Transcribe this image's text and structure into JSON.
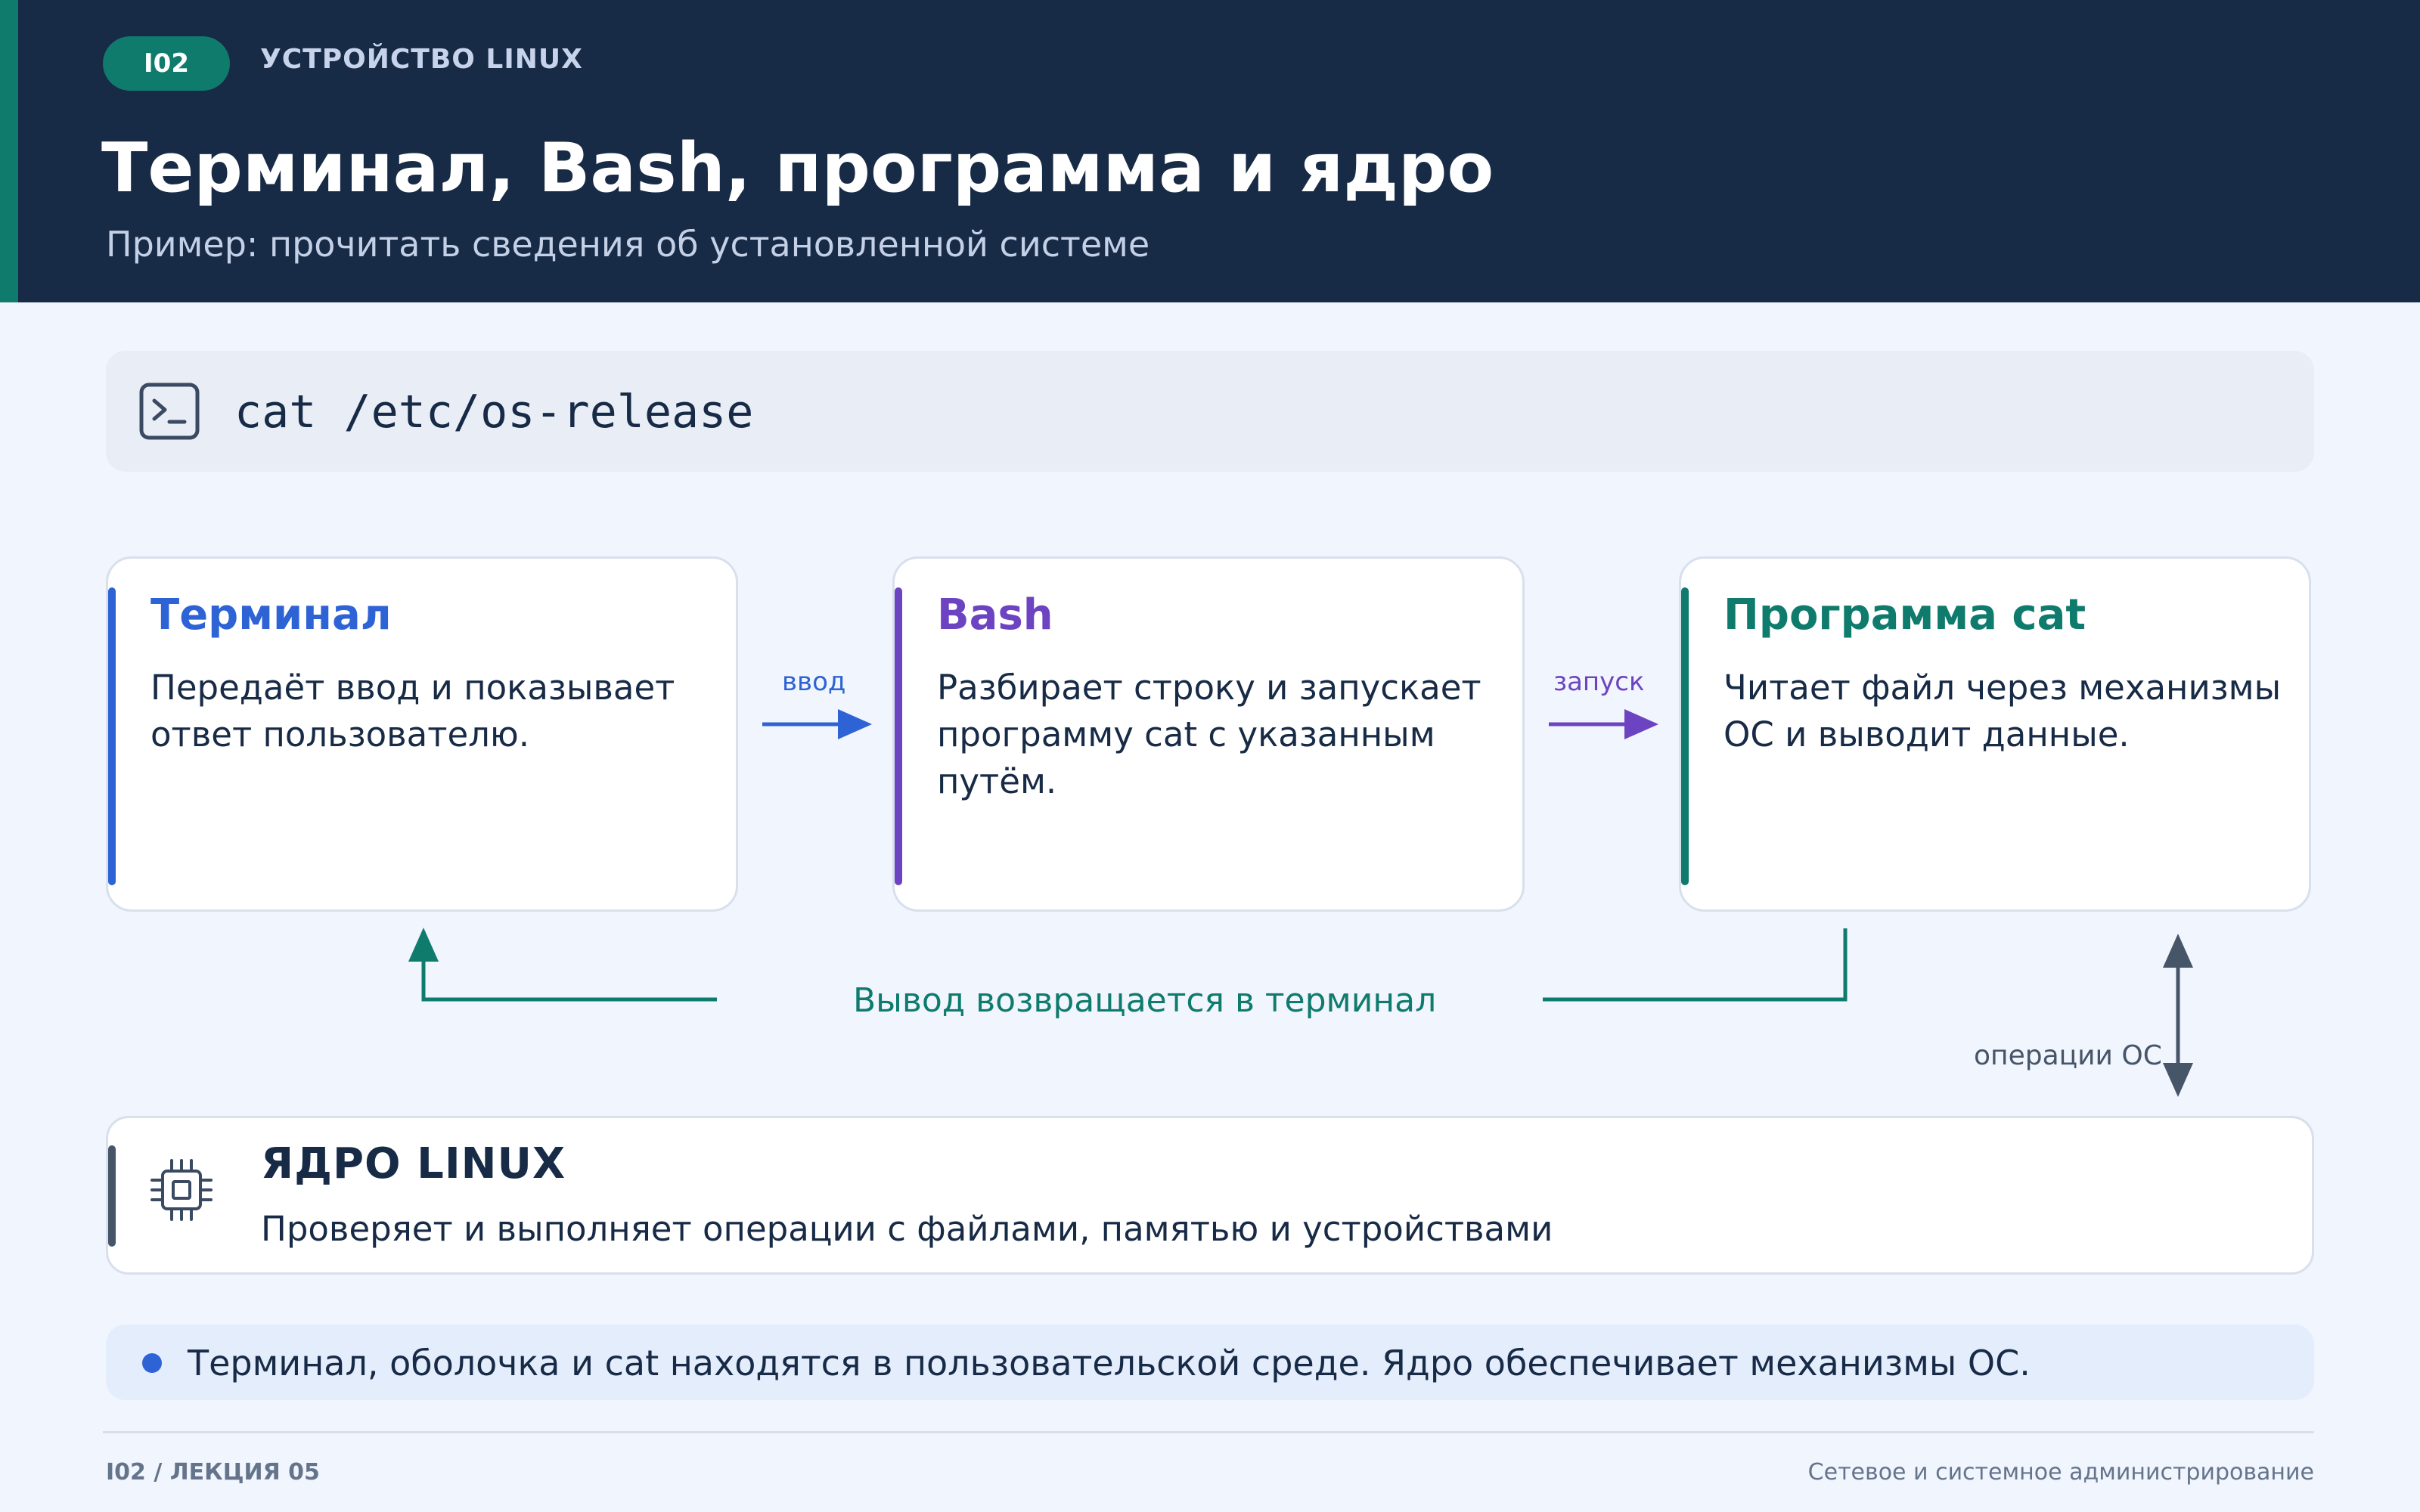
{
  "colors": {
    "navy": "#172a46",
    "teal": "#0f7b6d",
    "blue": "#2e63d6",
    "purple": "#6c44c2",
    "slate": "#475569"
  },
  "header": {
    "badge": "I02",
    "kicker": "УСТРОЙСТВО LINUX",
    "title": "Терминал, Bash, программа и ядро",
    "subtitle": "Пример: прочитать сведения об установленной системе"
  },
  "command": {
    "icon": "terminal-icon",
    "text": "cat /etc/os-release"
  },
  "cards": [
    {
      "title": "Терминал",
      "body": "Передаёт ввод и показывает ответ пользователю.",
      "color": "#2e63d6"
    },
    {
      "title": "Bash",
      "body": "Разбирает строку и запускает программу cat с указанным путём.",
      "color": "#6c44c2"
    },
    {
      "title": "Программа cat",
      "body": "Читает файл через механизмы ОС и выводит данные.",
      "color": "#0f7b6d"
    }
  ],
  "flows": {
    "input": "ввод",
    "launch": "запуск",
    "return": "Вывод возвращается в терминал",
    "os_ops": "операции ОС"
  },
  "kernel": {
    "icon": "cpu-chip-icon",
    "title": "ЯДРО LINUX",
    "description": "Проверяет и выполняет операции с файлами, памятью и устройствами"
  },
  "note": "Терминал, оболочка и cat находятся в пользовательской среде. Ядро обеспечивает механизмы ОС.",
  "footer": {
    "left": "I02 / ЛЕКЦИЯ 05",
    "right": "Сетевое и системное администрирование"
  }
}
